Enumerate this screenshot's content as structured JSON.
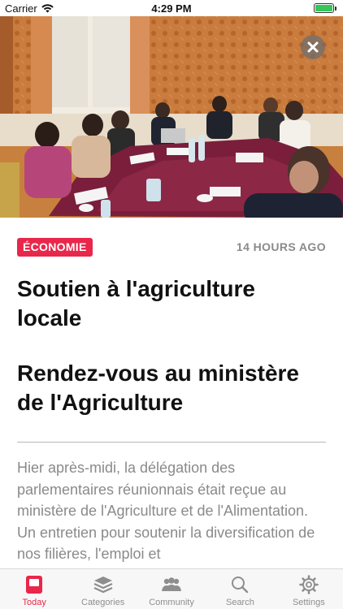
{
  "status_bar": {
    "carrier": "Carrier",
    "time": "4:29 PM"
  },
  "hero": {
    "image_alt": "meeting-photo",
    "close_icon": "close-icon"
  },
  "article": {
    "category": "ÉCONOMIE",
    "timestamp": "14 HOURS AGO",
    "title": "Soutien à l'agriculture locale",
    "subtitle": "Rendez-vous au ministère de l'Agriculture",
    "body": "Hier après-midi, la délégation des parlementaires réunionnais était reçue au ministère de l'Agriculture et de l'Alimentation. Un entretien pour soutenir la diversification de nos filières, l'emploi et"
  },
  "tab_bar": {
    "tabs": [
      {
        "label": "Today",
        "icon": "today-icon",
        "active": true
      },
      {
        "label": "Categories",
        "icon": "stack-icon",
        "active": false
      },
      {
        "label": "Community",
        "icon": "people-icon",
        "active": false
      },
      {
        "label": "Search",
        "icon": "search-icon",
        "active": false
      },
      {
        "label": "Settings",
        "icon": "gear-icon",
        "active": false
      }
    ]
  },
  "colors": {
    "accent": "#e8274b",
    "muted_text": "#8a8a8a",
    "battery": "#35c759"
  }
}
